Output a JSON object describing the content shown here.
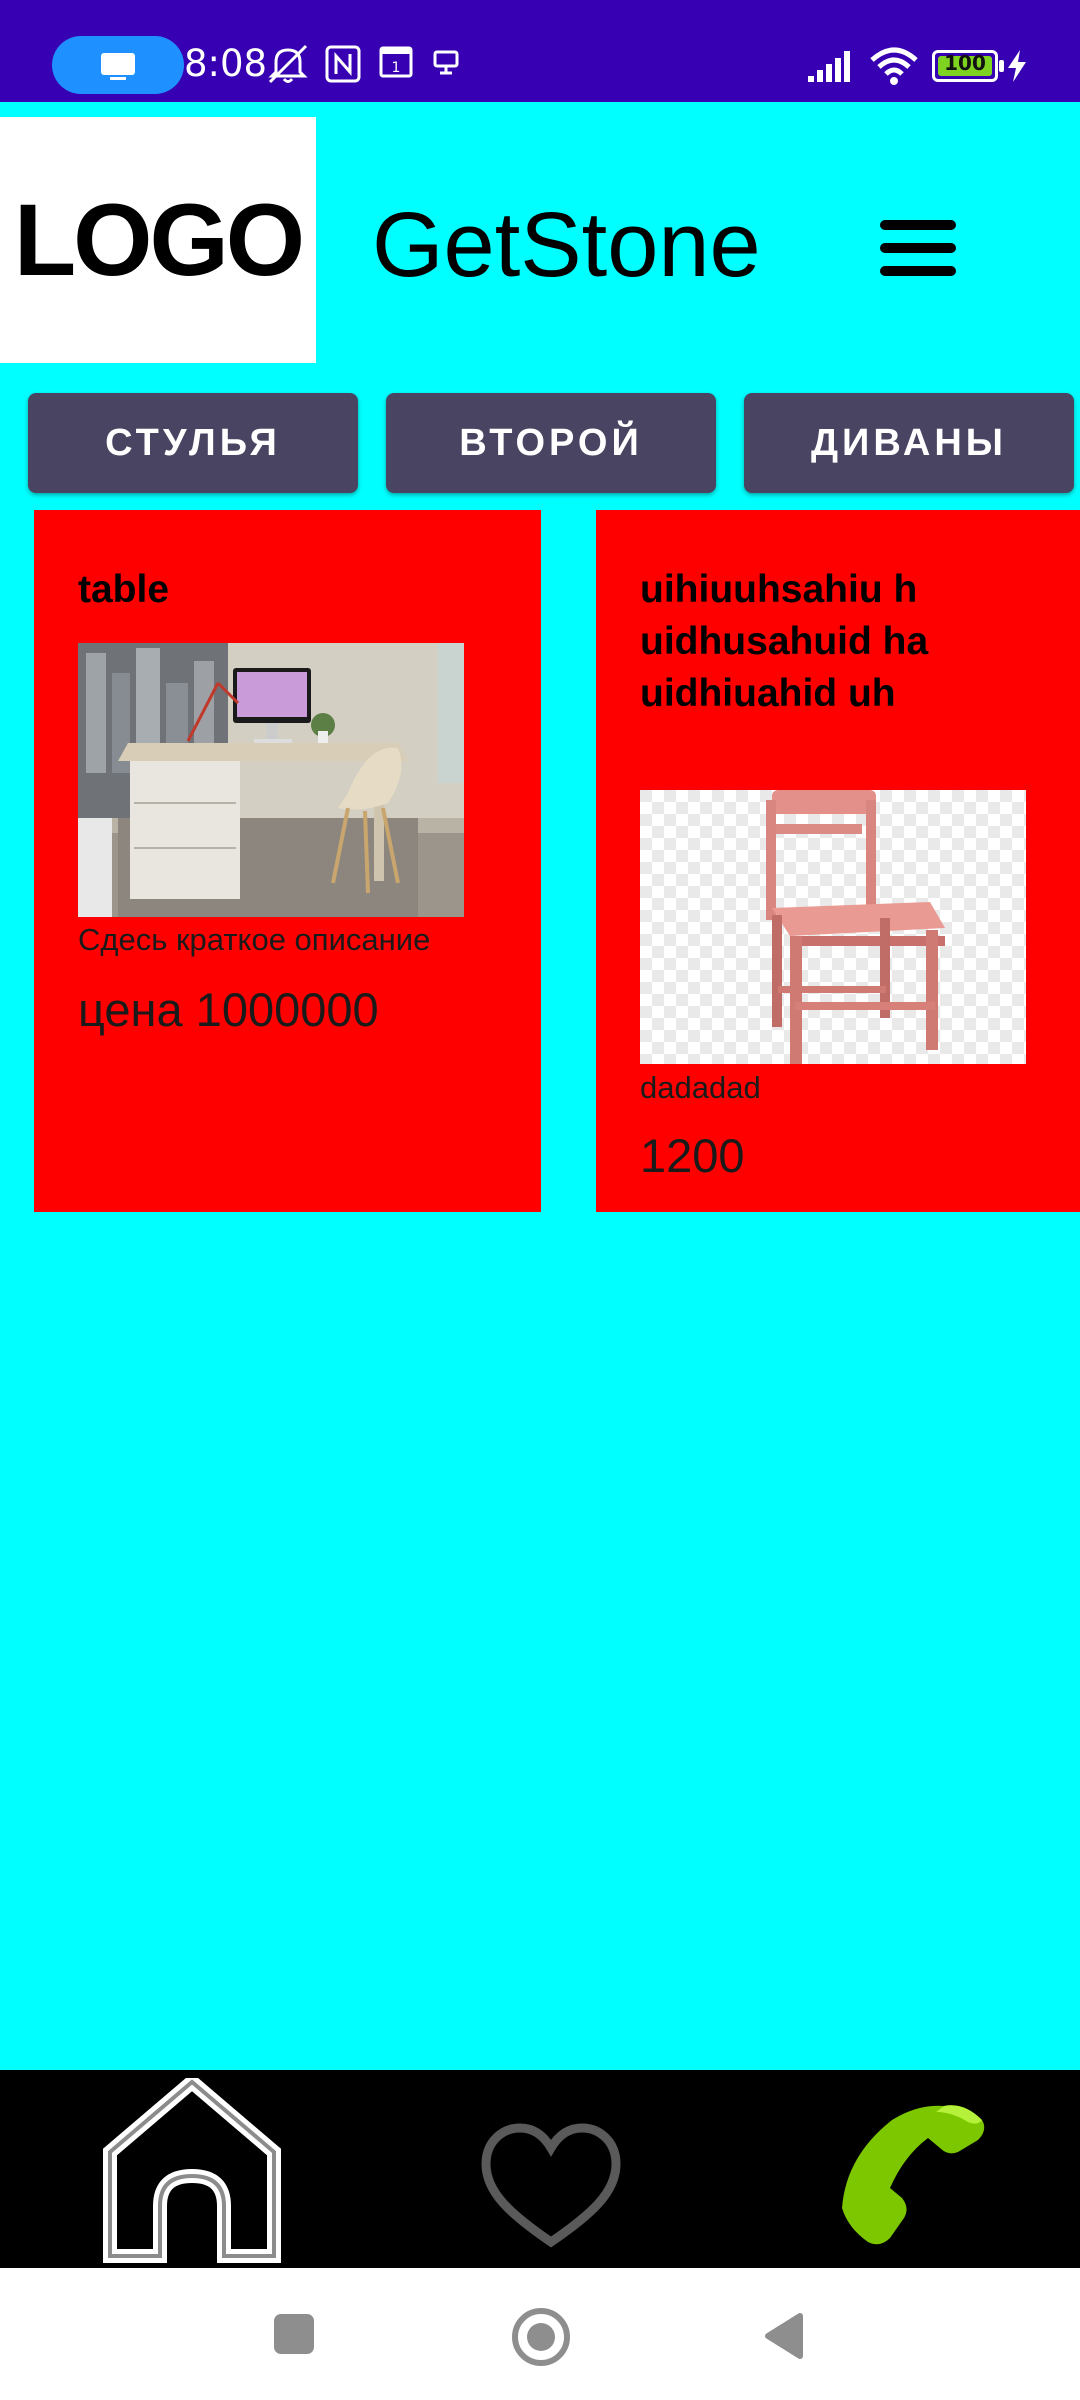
{
  "status_bar": {
    "time": "8:08",
    "battery": "100",
    "icons": [
      "screen-cast-icon",
      "mute-icon",
      "nfc-icon",
      "sim-icon",
      "desktop-icon",
      "signal-icon",
      "wifi-icon",
      "battery-icon",
      "charging-icon"
    ]
  },
  "header": {
    "logo": "LOGO",
    "title": "GetStone",
    "menu_icon": "hamburger-menu-icon"
  },
  "categories": [
    {
      "label": "СТУЛЬЯ"
    },
    {
      "label": "ВТОРОЙ"
    },
    {
      "label": "ДИВАНЫ"
    }
  ],
  "products": [
    {
      "title": "table",
      "description": "Сдесь краткое описание",
      "price": "цена  1000000",
      "image": "desk-photo"
    },
    {
      "title": "uihiuuhsahiu huidhusahuid hauidhiuahid uh",
      "description": "dadadad",
      "price": "1200",
      "image": "pink-chair-photo"
    }
  ],
  "bottom_nav": {
    "items": [
      "home-icon",
      "heart-icon",
      "phone-icon"
    ]
  },
  "system_nav": {
    "items": [
      "recents-icon",
      "home-circle-icon",
      "back-icon"
    ]
  },
  "colors": {
    "status_bar": "#3700B3",
    "background": "#00FFFF",
    "card": "#FF0000",
    "tab": "#484461",
    "phone": "#7CC700"
  }
}
